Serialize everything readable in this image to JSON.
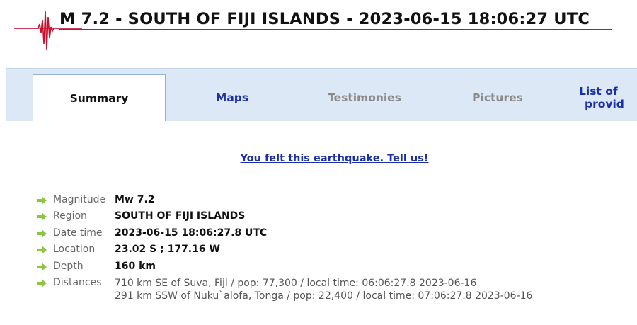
{
  "header": {
    "title": "M 7.2 - SOUTH OF FIJI ISLANDS - 2023-06-15 18:06:27 UTC",
    "accent_color": "#c8102e",
    "logo_icon": "seismogram-icon"
  },
  "tabs": [
    {
      "label": "Summary",
      "active": true
    },
    {
      "label": "Maps",
      "active": false
    },
    {
      "label": "Testimonies",
      "active": false
    },
    {
      "label": "Pictures",
      "active": false
    },
    {
      "label_line1": "List of",
      "label_line2": "provid",
      "active": false
    }
  ],
  "felt_link": "You felt this earthquake. Tell us!",
  "details": {
    "magnitude": {
      "label": "Magnitude",
      "value": "Mw 7.2"
    },
    "region": {
      "label": "Region",
      "value": "SOUTH OF FIJI ISLANDS"
    },
    "datetime": {
      "label": "Date time",
      "value": "2023-06-15 18:06:27.8 UTC"
    },
    "location": {
      "label": "Location",
      "value": "23.02 S ; 177.16 W"
    },
    "depth": {
      "label": "Depth",
      "value": "160 km"
    },
    "distances": {
      "label": "Distances",
      "lines": [
        "710 km SE of Suva, Fiji / pop: 77,300 / local time: 06:06:27.8 2023-06-16",
        "291 km SSW of Nuku`alofa, Tonga / pop: 22,400 / local time: 07:06:27.8 2023-06-16"
      ]
    }
  },
  "icons": {
    "bullet": "green-arrow-icon"
  },
  "colors": {
    "link": "#1a2fa8",
    "tabbar": "#dce8f5",
    "disabled_tab": "#8a8a8a",
    "bullet": "#8cc63f"
  }
}
